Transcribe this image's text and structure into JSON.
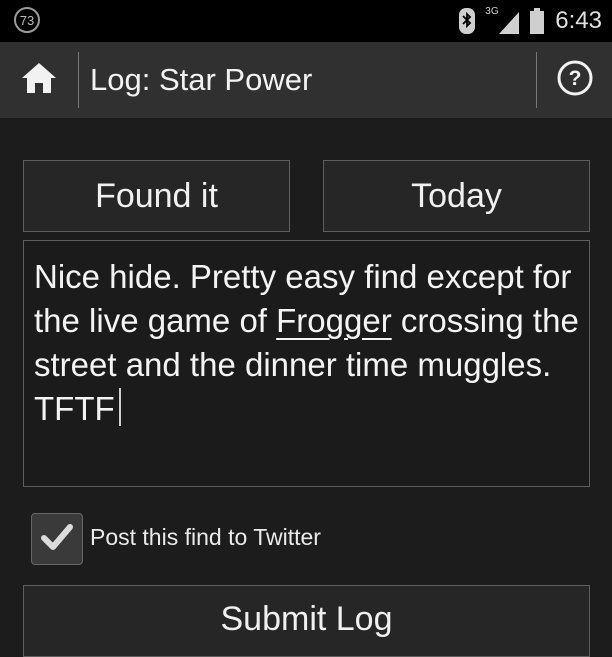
{
  "status_bar": {
    "notification_count": "73",
    "network_type": "3G",
    "time": "6:43",
    "icons": [
      "bluetooth-icon",
      "signal-icon",
      "battery-icon"
    ]
  },
  "action_bar": {
    "title": "Log: Star Power",
    "home_icon": "home-icon",
    "help_icon": "help-icon"
  },
  "log_form": {
    "type_button": "Found it",
    "date_button": "Today",
    "log_text_parts": {
      "before": "Nice hide. Pretty easy find except for the live game of ",
      "underlined": "Frogger",
      "after": " crossing the street and the dinner time muggles. TFTF"
    },
    "twitter_checked": true,
    "twitter_label": "Post this find to Twitter",
    "submit_label": "Submit Log"
  },
  "colors": {
    "background": "#1c1c1c",
    "action_bar": "#303030",
    "border": "#5e5e5e"
  }
}
